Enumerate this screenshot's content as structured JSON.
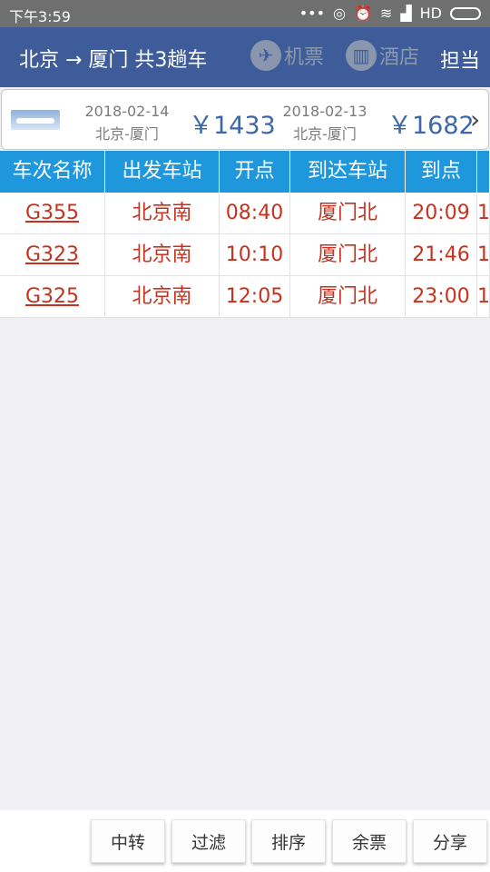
{
  "status_bar": {
    "time": "下午3:59",
    "network": "HD"
  },
  "header": {
    "title": "北京 → 厦门 共3趟车",
    "flights_label": "机票",
    "hotel_label": "酒店",
    "extra_label": "担当"
  },
  "flight_offers": [
    {
      "date": "2018-02-14",
      "route": "北京-厦门",
      "price": "￥1433"
    },
    {
      "date": "2018-02-13",
      "route": "北京-厦门",
      "price": "￥1682"
    }
  ],
  "table": {
    "columns": [
      "车次名称",
      "出发车站",
      "开点",
      "到达车站",
      "到点"
    ],
    "rows": [
      {
        "train": "G355",
        "from": "北京南",
        "depart": "08:40",
        "to": "厦门北",
        "arrive": "20:09",
        "extra": "1"
      },
      {
        "train": "G323",
        "from": "北京南",
        "depart": "10:10",
        "to": "厦门北",
        "arrive": "21:46",
        "extra": "1"
      },
      {
        "train": "G325",
        "from": "北京南",
        "depart": "12:05",
        "to": "厦门北",
        "arrive": "23:00",
        "extra": "1"
      }
    ]
  },
  "bottom_buttons": {
    "transfer": "中转",
    "filter": "过滤",
    "sort": "排序",
    "tickets": "余票",
    "share": "分享"
  },
  "colors": {
    "header_bg": "#3e5c99",
    "table_header_bg": "#1e97dc",
    "row_text": "#c8311e",
    "price_text": "#3c67aa"
  }
}
